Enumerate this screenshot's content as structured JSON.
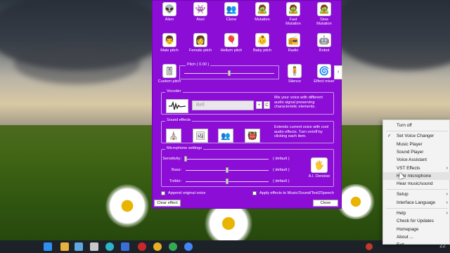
{
  "effects_row1": [
    {
      "label": "Alien",
      "icon": "alien-icon",
      "glyph": "👽"
    },
    {
      "label": "Atari",
      "icon": "atari-icon",
      "glyph": "👾"
    },
    {
      "label": "Clone",
      "icon": "clone-icon",
      "glyph": "👥"
    },
    {
      "label": "Mutation",
      "icon": "mutation-icon",
      "glyph": "🧟"
    },
    {
      "label": "Fast\nMutation",
      "icon": "fast-mutation-icon",
      "glyph": "🧟"
    },
    {
      "label": "Slow\nMutation",
      "icon": "slow-mutation-icon",
      "glyph": "🧟"
    }
  ],
  "effects_row2": [
    {
      "label": "Male pitch",
      "icon": "male-face-icon",
      "glyph": "👨"
    },
    {
      "label": "Female pitch",
      "icon": "female-face-icon",
      "glyph": "👩"
    },
    {
      "label": "Helium pitch",
      "icon": "helium-balloon-icon",
      "glyph": "🎈"
    },
    {
      "label": "Baby pitch",
      "icon": "baby-face-icon",
      "glyph": "👶"
    },
    {
      "label": "Radio",
      "icon": "radio-icon",
      "glyph": "📻"
    },
    {
      "label": "Robot",
      "icon": "robot-icon",
      "glyph": "🤖"
    }
  ],
  "pitch": {
    "custom_label": "Custom pitch",
    "title": "Pitch ( 0.00 )",
    "value": 0.0,
    "silence_label": "Silence",
    "effect_mixer_label": "Effect mixer"
  },
  "vocoder": {
    "title": "Vocoder",
    "voice": "Bell",
    "plus_label": "+",
    "clear_label": "C",
    "description": "Mix your voice with different audio signal preserving characteristic elements."
  },
  "sound_effects": {
    "title": "Sound effects",
    "description": "Extends current voice with cool audio effects. Turn on/off by clicking each item."
  },
  "microphone": {
    "title": "Microphone settings",
    "rows": [
      {
        "label": "Sensitivity:",
        "value_fraction": 0.0,
        "default": "( default )"
      },
      {
        "label": "Bass:",
        "value_fraction": 0.5,
        "default": "( default )"
      },
      {
        "label": "Treble:",
        "value_fraction": 0.5,
        "default": "( default )"
      }
    ],
    "denoise_label": "A.I. Denoise"
  },
  "options": {
    "append_original": "Append original voice",
    "apply_effects": "Apply effects to Music/Sound/Text2Speech"
  },
  "buttons": {
    "clear_effect": "Clear effect",
    "close": "Close"
  },
  "tray_menu": {
    "items": [
      {
        "label": "Turn off",
        "checked": false,
        "submenu": false
      },
      {
        "label": "Set Voice Changer",
        "checked": true,
        "submenu": false
      },
      {
        "label": "Music Player",
        "checked": false,
        "submenu": false
      },
      {
        "label": "Sound Player",
        "checked": false,
        "submenu": false
      },
      {
        "label": "Voice Assistant",
        "checked": false,
        "submenu": false
      },
      {
        "label": "VST Effects",
        "checked": false,
        "submenu": true
      },
      {
        "label": "Hear microphone",
        "checked": false,
        "submenu": false
      },
      {
        "label": "Hear music/sound",
        "checked": false,
        "submenu": false
      },
      {
        "label": "Setup",
        "checked": false,
        "submenu": true
      },
      {
        "label": "Interface Language",
        "checked": false,
        "submenu": true
      },
      {
        "label": "Help",
        "checked": false,
        "submenu": true
      },
      {
        "label": "Check for Updates",
        "checked": false,
        "submenu": false
      },
      {
        "label": "Homepage",
        "checked": false,
        "submenu": false
      },
      {
        "label": "About ...",
        "checked": false,
        "submenu": false
      },
      {
        "label": "Exit",
        "checked": false,
        "submenu": false
      }
    ]
  },
  "taskbar": {
    "time": "22"
  },
  "colors": {
    "app_background": "#8b0dd6",
    "menu_background": "#f3f3f3"
  }
}
